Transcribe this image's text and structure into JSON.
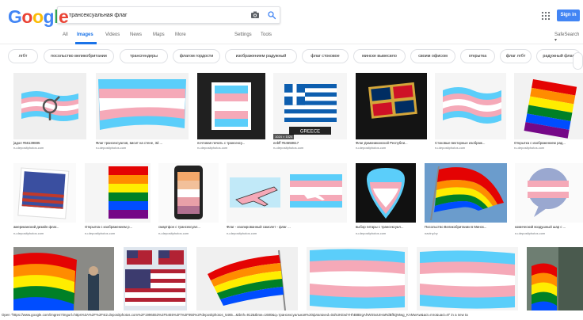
{
  "header": {
    "logo": "Google",
    "search_value": "трансексуальная флаг",
    "signin_label": "Sign in",
    "safesearch_label": "SafeSearch ▾",
    "colors": {
      "brand_blue": "#4285f4",
      "active_tab": "#1a73e8"
    }
  },
  "tabs": {
    "all": "All",
    "images": "Images",
    "videos": "Videos",
    "news": "News",
    "maps": "Maps",
    "more": "More",
    "settings": "Settings",
    "tools": "Tools"
  },
  "chips": [
    "лгбт",
    "посольство великобритании",
    "трансгендеры",
    "флагом гордости",
    "изображением радужный",
    "флаг стоковое",
    "минске вывесило",
    "своим офисом",
    "открытка",
    "флаг лгбт",
    "радужный флаг"
  ],
  "results": {
    "row1": [
      {
        "caption": "јадол #56139885",
        "source": "ru.depositphotos.com",
        "icon": "trans-symbol-flag-icon"
      },
      {
        "caption": "Флаг трансексуалов, висит на стене, 3d ...",
        "source": "ru.depositphotos.com",
        "icon": "trans-banner-icon"
      },
      {
        "caption": "почтовая печать с трансексу...",
        "source": "ru.depositphotos.com",
        "icon": "trans-stamp-icon"
      },
      {
        "caption": "eebff #54658617",
        "source": "ru.depositphotos.com",
        "icon": "greece-flag-icon",
        "badge": "1024 × 1024",
        "overlay": "GREECE"
      },
      {
        "caption": "Флаг Доминиканской Республи...",
        "source": "ru.depositphotos.com",
        "icon": "dominican-pin-icon"
      },
      {
        "caption": "Стоковые векторные изображ...",
        "source": "ru.depositphotos.com",
        "icon": "trans-wave-icon"
      },
      {
        "caption": "Открытка с изображением рад...",
        "source": "ru.depositphotos.com",
        "icon": "rainbow-card-icon"
      }
    ],
    "row2": [
      {
        "caption": "американский дизайн флаг...",
        "source": "ru.depositphotos.com",
        "icon": "usa-polaroid-icon"
      },
      {
        "caption": "Открытка с изображением р...",
        "source": "ru.depositphotos.com",
        "icon": "rainbow-card-icon"
      },
      {
        "caption": "смартфон с трансексуал...",
        "source": "ru.depositphotos.com",
        "icon": "phone-flag-icon"
      },
      {
        "caption": "Флаг - изолированный самолет - флаг ...",
        "source": "ru.depositphotos.com",
        "icon": "plane-flag-icon"
      },
      {
        "caption": "выбор гитары с трансексуал...",
        "source": "ru.depositphotos.com",
        "icon": "guitar-pick-icon"
      },
      {
        "caption": "Посольство Великобритании в Минск...",
        "source": "naviny.by",
        "icon": "rainbow-wave-icon"
      },
      {
        "caption": "комический воздушный шар с ...",
        "source": "ru.depositphotos.com",
        "icon": "speech-bubble-icon"
      }
    ],
    "row3": [
      {
        "icon": "rainbow-street-icon"
      },
      {
        "icon": "usa-flags-icon"
      },
      {
        "icon": "rainbow-flag-sky-icon"
      },
      {
        "icon": "trans-flag-wave-icon"
      },
      {
        "icon": "trans-flag-wave-icon"
      },
      {
        "icon": "rainbow-building-icon"
      }
    ]
  },
  "status_bar": "Open \"https://www.google.com/imgres?imgurl=https%3A%2F%2Fst2.depositphotos.com%2F1996553%2F5465%2Fi%2F950%2Fdepositphotos_5465...&tbnh=912&tbnw=1680&q=трансексуальная%20флаг&ved=0ahUKEwiYHhB8BrgAhWS5xUIHaRdBfkQMwg_KAMwAw&act=mrc&uact=8\" in a new ta"
}
